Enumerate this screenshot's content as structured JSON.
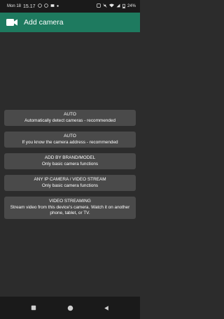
{
  "status_bar": {
    "date": "Mon 18",
    "time": "15.17",
    "battery": "24%"
  },
  "app_bar": {
    "title": "Add camera"
  },
  "options": [
    {
      "title": "AUTO",
      "subtitle": "Automatically detect cameras - recommended"
    },
    {
      "title": "AUTO",
      "subtitle": "If you know the camera address - recommended"
    },
    {
      "title": "ADD BY BRAND/MODEL",
      "subtitle": "Only basic camera functions"
    },
    {
      "title": "ANY IP CAMERA / VIDEO STREAM",
      "subtitle": "Only basic camera functions"
    },
    {
      "title": "VIDEO STREAMING",
      "subtitle": "Stream video from this device's camera. Watch it on another phone, tablet, or TV."
    }
  ],
  "colors": {
    "app_bar": "#1e7a5f",
    "background": "#2c2c2c",
    "button": "#4a4a4a"
  }
}
